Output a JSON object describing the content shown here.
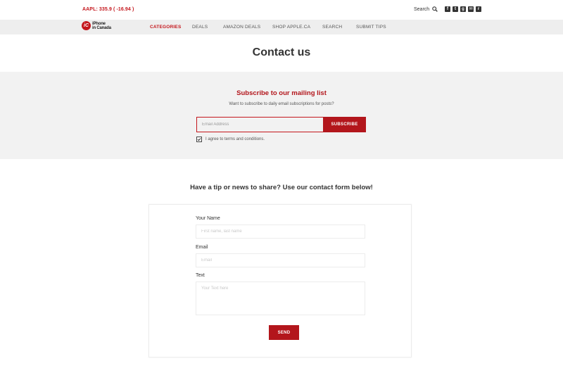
{
  "topbar": {
    "ticker": "AAPL: 335.9 ( -16.94 )",
    "search_label": "Search",
    "socials": [
      {
        "icon": "facebook-icon",
        "glyph": "f"
      },
      {
        "icon": "twitter-icon",
        "glyph": "t"
      },
      {
        "icon": "google-plus-icon",
        "glyph": "g"
      },
      {
        "icon": "mail-icon",
        "glyph": "✉"
      },
      {
        "icon": "rss-icon",
        "glyph": "r"
      }
    ]
  },
  "logo": {
    "mark": "iC",
    "line1": "iPhone",
    "line2": "in Canada"
  },
  "nav": {
    "items": [
      "CATEGORIES",
      "DEALS",
      "AMAZON DEALS",
      "SHOP APPLE.CA",
      "SEARCH",
      "SUBMIT TIPS"
    ],
    "active": "CATEGORIES"
  },
  "page": {
    "title": "Contact us"
  },
  "subscribe": {
    "title": "Subscribe to our mailing list",
    "description": "Want to subscribe to daily email subscriptions for posts?",
    "email_placeholder": "Email Address",
    "button_label": "SUBSCRIBE",
    "agree_label": "I agree to terms and conditions.",
    "agree_checked": true
  },
  "contact": {
    "heading": "Have a tip or news to share? Use our contact form below!",
    "name_label": "Your Name",
    "name_placeholder": "First name, last name",
    "email_label": "Email",
    "email_placeholder": "Email",
    "text_label": "Text",
    "text_placeholder": "Your Text here",
    "send_label": "SEND"
  },
  "colors": {
    "brand_red": "#b3161c",
    "nav_bg": "#eeeeee",
    "band_bg": "#f2f2f2"
  }
}
